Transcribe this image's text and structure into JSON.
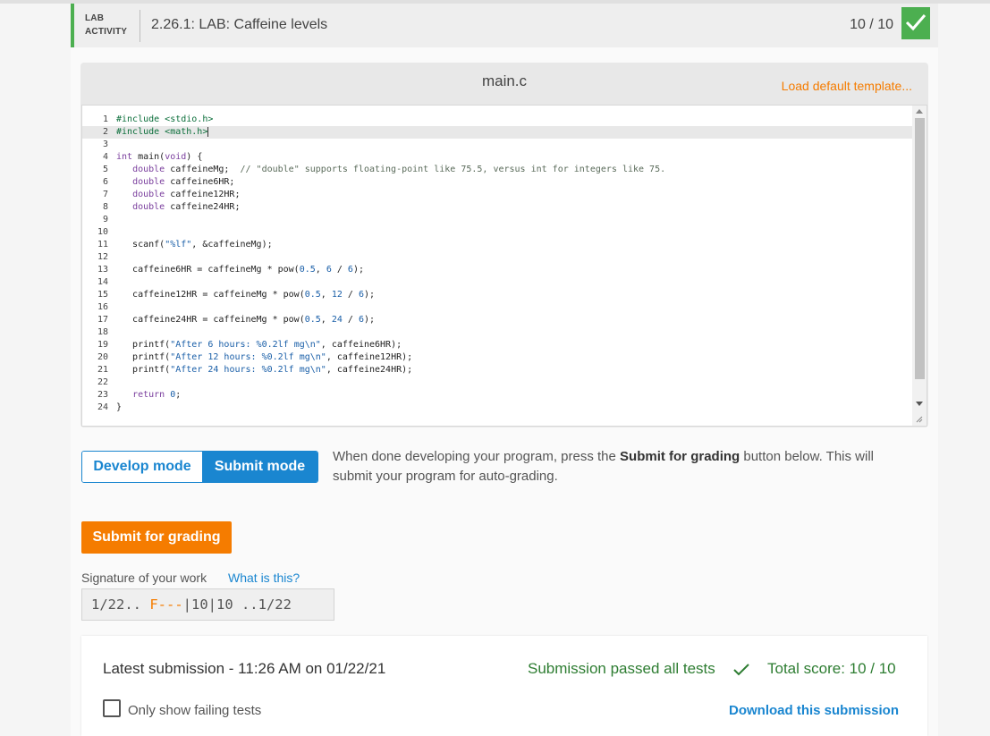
{
  "header": {
    "tag_line1": "LAB",
    "tag_line2": "ACTIVITY",
    "title": "2.26.1: LAB: Caffeine levels",
    "score": "10 / 10",
    "badge_icon": "check-icon",
    "accent_color": "#4caf50"
  },
  "editor": {
    "file_name": "main.c",
    "load_template": "Load default template...",
    "active_line": 2,
    "lines": [
      "#include <stdio.h>",
      "#include <math.h>",
      "",
      "int main(void) {",
      "   double caffeineMg;  // \"double\" supports floating-point like 75.5, versus int for integers like 75.",
      "   double caffeine6HR;",
      "   double caffeine12HR;",
      "   double caffeine24HR;",
      "",
      "",
      "   scanf(\"%lf\", &caffeineMg);",
      "",
      "   caffeine6HR = caffeineMg * pow(0.5, 6 / 6);",
      "",
      "   caffeine12HR = caffeineMg * pow(0.5, 12 / 6);",
      "",
      "   caffeine24HR = caffeineMg * pow(0.5, 24 / 6);",
      "",
      "   printf(\"After 6 hours: %0.2lf mg\\n\", caffeine6HR);",
      "   printf(\"After 12 hours: %0.2lf mg\\n\", caffeine12HR);",
      "   printf(\"After 24 hours: %0.2lf mg\\n\", caffeine24HR);",
      "",
      "   return 0;",
      "}"
    ]
  },
  "mode": {
    "develop_label": "Develop mode",
    "submit_label": "Submit mode",
    "help_prefix": "When done developing your program, press the ",
    "help_bold": "Submit for grading",
    "help_suffix": " button below. This will submit your program for auto-grading."
  },
  "submit_button": "Submit for grading",
  "signature": {
    "label": "Signature of your work",
    "help_link": "What is this?",
    "part1": "1/22.. ",
    "part2": "F---",
    "part3": "|10|10 ..1/22"
  },
  "results": {
    "latest": "Latest submission - 11:26 AM on 01/22/21",
    "passed": "Submission passed all tests",
    "total": "Total score: 10 / 10",
    "filter_label": "Only show failing tests",
    "download": "Download this submission"
  }
}
